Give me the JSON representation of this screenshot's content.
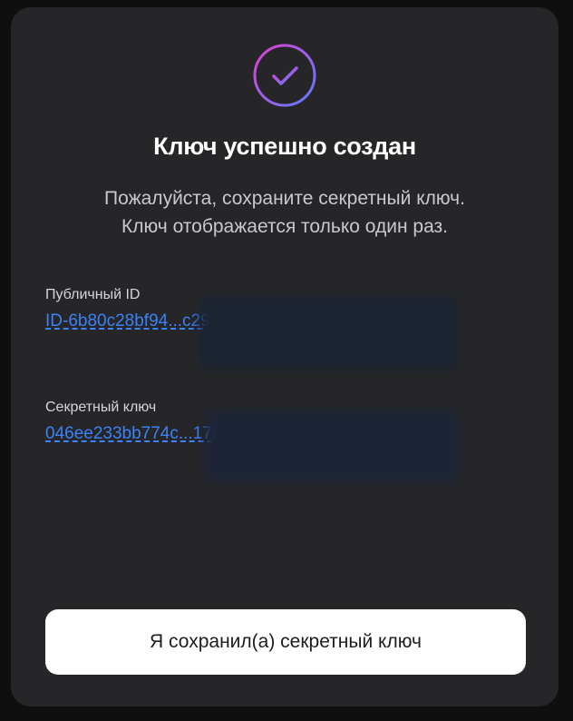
{
  "dialog": {
    "title": "Ключ успешно создан",
    "subtitle_line1": "Пожалуйста, сохраните секретный ключ.",
    "subtitle_line2": "Ключ отображается только один раз."
  },
  "public_id": {
    "label": "Публичный ID",
    "value": "ID-6b80c28bf94...c2918 60ee4122a3ebd9..."
  },
  "secret_key": {
    "label": "Секретный ключ",
    "value": "046ee233bb774c...17938b d4c8d9b66ed97c..."
  },
  "confirm_button": {
    "label": "Я сохранил(а) секретный ключ"
  },
  "icons": {
    "success": "check-circle-icon"
  },
  "colors": {
    "link": "#3b82f6",
    "gradient_start": "#e040d0",
    "gradient_end": "#5b7cff"
  }
}
